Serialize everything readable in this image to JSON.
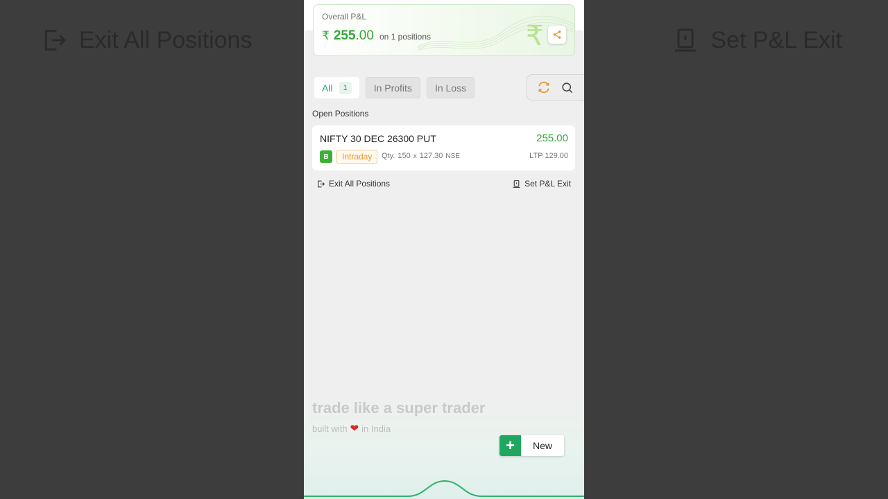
{
  "background": {
    "left_label": "Exit All Positions",
    "right_label": "Set P&L Exit"
  },
  "pl_card": {
    "title": "Overall P&L",
    "currency_symbol": "₹",
    "value_int": "255",
    "value_dec": ".00",
    "note": "on 1 positions",
    "accent_color": "#35a835"
  },
  "tabs": [
    {
      "label": "All",
      "count": "1",
      "active": true
    },
    {
      "label": "In Profits",
      "active": false
    },
    {
      "label": "In Loss",
      "active": false
    }
  ],
  "section_label": "Open Positions",
  "position": {
    "symbol": "NIFTY 30 DEC 26300 PUT",
    "pnl": "255.00",
    "side": "B",
    "product": "Intraday",
    "qty_label": "Qty.",
    "qty": "150",
    "times": "x",
    "avg_price": "127.30",
    "exchange": "NSE",
    "ltp": "LTP  129.00"
  },
  "actions": {
    "exit_all": "Exit All Positions",
    "set_pl_exit": "Set P&L Exit"
  },
  "footer": {
    "tagline": "trade like a super trader",
    "built_prefix": "built with",
    "built_suffix": "in India",
    "heart": "❤"
  },
  "new_button": {
    "plus": "+",
    "label": "New"
  },
  "icons": {
    "share": "share-icon",
    "refresh": "refresh-icon",
    "search": "search-icon",
    "exit": "exit-icon",
    "set_pl": "set-pl-exit-icon"
  }
}
